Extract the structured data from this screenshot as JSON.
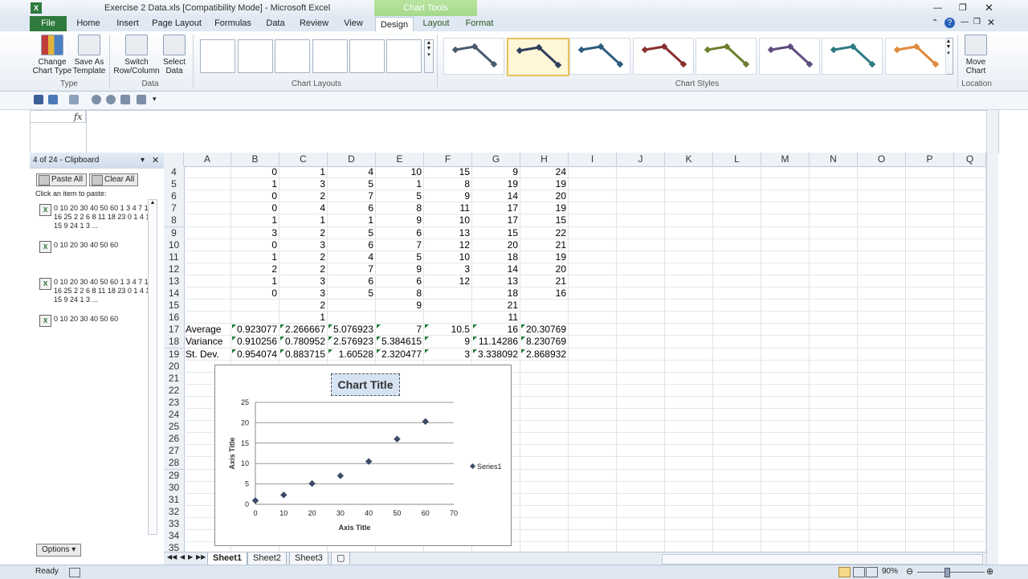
{
  "window": {
    "title": "Exercise 2 Data.xls  [Compatibility Mode]  -  Microsoft Excel",
    "context_tab": "Chart Tools"
  },
  "tabs": [
    "File",
    "Home",
    "Insert",
    "Page Layout",
    "Formulas",
    "Data",
    "Review",
    "View",
    "Design",
    "Layout",
    "Format"
  ],
  "ribbon": {
    "type_group": {
      "label": "Type",
      "change": "Change Chart Type",
      "save": "Save As Template"
    },
    "data_group": {
      "label": "Data",
      "switch": "Switch Row/Column",
      "select": "Select Data"
    },
    "layouts_group": {
      "label": "Chart Layouts"
    },
    "styles_group": {
      "label": "Chart Styles",
      "colors": [
        "#4a5b6e",
        "#2f3f5a",
        "#2e5d7e",
        "#8a2f2f",
        "#6c7f2e",
        "#5e4d7d",
        "#2f7a84",
        "#e08a3c"
      ]
    },
    "location_group": {
      "label": "Location",
      "move": "Move Chart"
    }
  },
  "formula": {
    "fx": "fx",
    "value": ""
  },
  "clipboard": {
    "header": "4 of 24 - Clipboard",
    "paste_all": "Paste All",
    "clear_all": "Clear All",
    "hint": "Click an item to paste:",
    "items": [
      "0 10 20 30 40 50 60 1 3 4 7 12 16 25 2 2 6 8 11 18 23 0 1 4 10 15 9 24 1 3 ...",
      "0 10 20 30 40 50 60",
      "0 10 20 30 40 50 60 1 3 4 7 12 16 25 2 2 6 8 11 18 23 0 1 4 10 15 9 24 1 3 ...",
      "0 10 20 30 40 50 60"
    ],
    "options": "Options"
  },
  "sheet": {
    "columns": [
      "A",
      "B",
      "C",
      "D",
      "E",
      "F",
      "G",
      "H",
      "I",
      "J",
      "K",
      "L",
      "M",
      "N",
      "O",
      "P",
      "Q"
    ],
    "rows": [
      {
        "n": "4",
        "cells": [
          "",
          "0",
          "1",
          "4",
          "10",
          "15",
          "9",
          "24"
        ]
      },
      {
        "n": "5",
        "cells": [
          "",
          "1",
          "3",
          "5",
          "1",
          "8",
          "19",
          "19"
        ]
      },
      {
        "n": "6",
        "cells": [
          "",
          "0",
          "2",
          "7",
          "5",
          "9",
          "14",
          "20"
        ]
      },
      {
        "n": "7",
        "cells": [
          "",
          "0",
          "4",
          "6",
          "8",
          "11",
          "17",
          "19"
        ]
      },
      {
        "n": "8",
        "cells": [
          "",
          "1",
          "1",
          "1",
          "9",
          "10",
          "17",
          "15"
        ]
      },
      {
        "n": "9",
        "cells": [
          "",
          "3",
          "2",
          "5",
          "6",
          "13",
          "15",
          "22"
        ]
      },
      {
        "n": "10",
        "cells": [
          "",
          "0",
          "3",
          "6",
          "7",
          "12",
          "20",
          "21"
        ]
      },
      {
        "n": "11",
        "cells": [
          "",
          "1",
          "2",
          "4",
          "5",
          "10",
          "18",
          "19"
        ]
      },
      {
        "n": "12",
        "cells": [
          "",
          "2",
          "2",
          "7",
          "9",
          "3",
          "14",
          "20"
        ]
      },
      {
        "n": "13",
        "cells": [
          "",
          "1",
          "3",
          "6",
          "6",
          "12",
          "13",
          "21"
        ]
      },
      {
        "n": "14",
        "cells": [
          "",
          "0",
          "3",
          "5",
          "8",
          "",
          "18",
          "16"
        ]
      },
      {
        "n": "15",
        "cells": [
          "",
          "",
          "2",
          "",
          "9",
          "",
          "21",
          ""
        ]
      },
      {
        "n": "16",
        "cells": [
          "",
          "",
          "1",
          "",
          "",
          "",
          "11",
          ""
        ]
      },
      {
        "n": "17",
        "cells": [
          "Average",
          "0.923077",
          "2.266667",
          "5.076923",
          "7",
          "10.5",
          "16",
          "20.30769"
        ]
      },
      {
        "n": "18",
        "cells": [
          "Variance",
          "0.910256",
          "0.780952",
          "2.576923",
          "5.384615",
          "9",
          "11.14286",
          "8.230769"
        ]
      },
      {
        "n": "19",
        "cells": [
          "St. Dev.",
          "0.954074",
          "0.883715",
          "1.60528",
          "2.320477",
          "3",
          "3.338092",
          "2.868932"
        ]
      },
      {
        "n": "20",
        "cells": []
      },
      {
        "n": "21",
        "cells": []
      },
      {
        "n": "22",
        "cells": []
      },
      {
        "n": "23",
        "cells": []
      },
      {
        "n": "24",
        "cells": []
      },
      {
        "n": "25",
        "cells": []
      },
      {
        "n": "26",
        "cells": []
      },
      {
        "n": "27",
        "cells": []
      },
      {
        "n": "28",
        "cells": []
      },
      {
        "n": "29",
        "cells": []
      },
      {
        "n": "30",
        "cells": []
      },
      {
        "n": "31",
        "cells": []
      },
      {
        "n": "32",
        "cells": []
      },
      {
        "n": "33",
        "cells": []
      },
      {
        "n": "34",
        "cells": []
      },
      {
        "n": "35",
        "cells": []
      }
    ]
  },
  "chart_data": {
    "type": "scatter",
    "title": "Chart Title",
    "xlabel": "Axis Title",
    "ylabel": "Axis Title",
    "xlim": [
      0,
      70
    ],
    "ylim": [
      0,
      25
    ],
    "xticks": [
      0,
      10,
      20,
      30,
      40,
      50,
      60,
      70
    ],
    "yticks": [
      0,
      5,
      10,
      15,
      20,
      25
    ],
    "grid": "horizontal",
    "legend": "right",
    "series": [
      {
        "name": "Series1",
        "color": "#3a4b66",
        "x": [
          0,
          10,
          20,
          30,
          40,
          50,
          60
        ],
        "y": [
          0.9,
          2.3,
          5.1,
          7,
          10.5,
          16,
          20.3
        ]
      }
    ]
  },
  "sheet_tabs": [
    "Sheet1",
    "Sheet2",
    "Sheet3"
  ],
  "status": {
    "ready": "Ready",
    "zoom": "90%"
  }
}
